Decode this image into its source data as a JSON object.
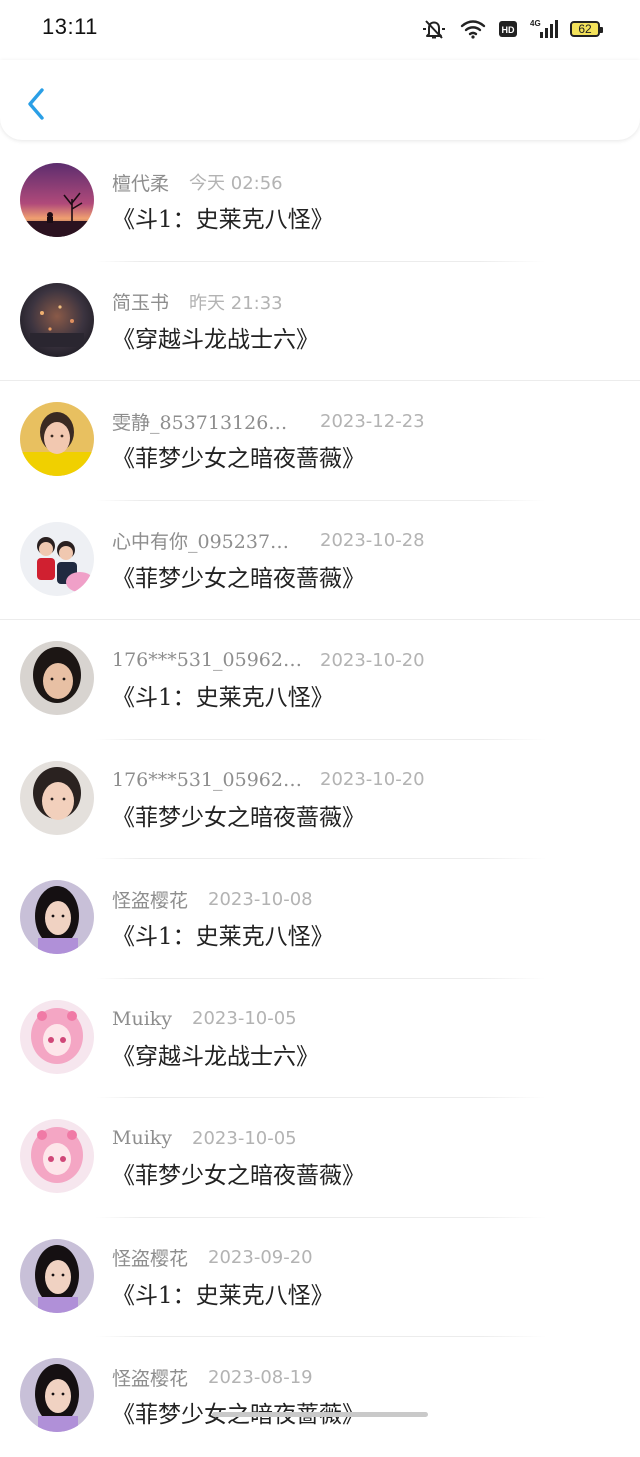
{
  "status_bar": {
    "time": "13:11",
    "network": "4G",
    "hd": "HD",
    "battery": "62"
  },
  "rows": [
    {
      "name": "檀代柔",
      "time": "今天 02:56",
      "title": "《斗1：史莱克八怪》",
      "avatar": "sunset"
    },
    {
      "name": "简玉书",
      "time": "昨天 21:33",
      "title": "《穿越斗龙战士六》",
      "avatar": "city-night"
    },
    {
      "name": "雯静_853713126…",
      "time": "2023-12-23",
      "title": "《菲梦少女之暗夜蔷薇》",
      "avatar": "person-yellow"
    },
    {
      "name": "心中有你_095237…",
      "time": "2023-10-28",
      "title": "《菲梦少女之暗夜蔷薇》",
      "avatar": "kids"
    },
    {
      "name": "176***531_05962…",
      "time": "2023-10-20",
      "title": "《斗1：史莱克八怪》",
      "avatar": "person-dark"
    },
    {
      "name": "176***531_05962…",
      "time": "2023-10-20",
      "title": "《菲梦少女之暗夜蔷薇》",
      "avatar": "person-light"
    },
    {
      "name": "怪盗樱花",
      "time": "2023-10-08",
      "title": "《斗1：史莱克八怪》",
      "avatar": "person-purple"
    },
    {
      "name": "Muiky",
      "time": "2023-10-05",
      "title": "《穿越斗龙战士六》",
      "avatar": "anime-pink"
    },
    {
      "name": "Muiky",
      "time": "2023-10-05",
      "title": "《菲梦少女之暗夜蔷薇》",
      "avatar": "anime-pink"
    },
    {
      "name": "怪盗樱花",
      "time": "2023-09-20",
      "title": "《斗1：史莱克八怪》",
      "avatar": "person-purple"
    },
    {
      "name": "怪盗樱花",
      "time": "2023-08-19",
      "title": "《菲梦少女之暗夜蔷薇》",
      "avatar": "person-purple"
    }
  ],
  "colors": {
    "accent": "#2a9fe6",
    "name": "#8e8e8e",
    "time": "#b3b3b3",
    "title": "#222222"
  }
}
